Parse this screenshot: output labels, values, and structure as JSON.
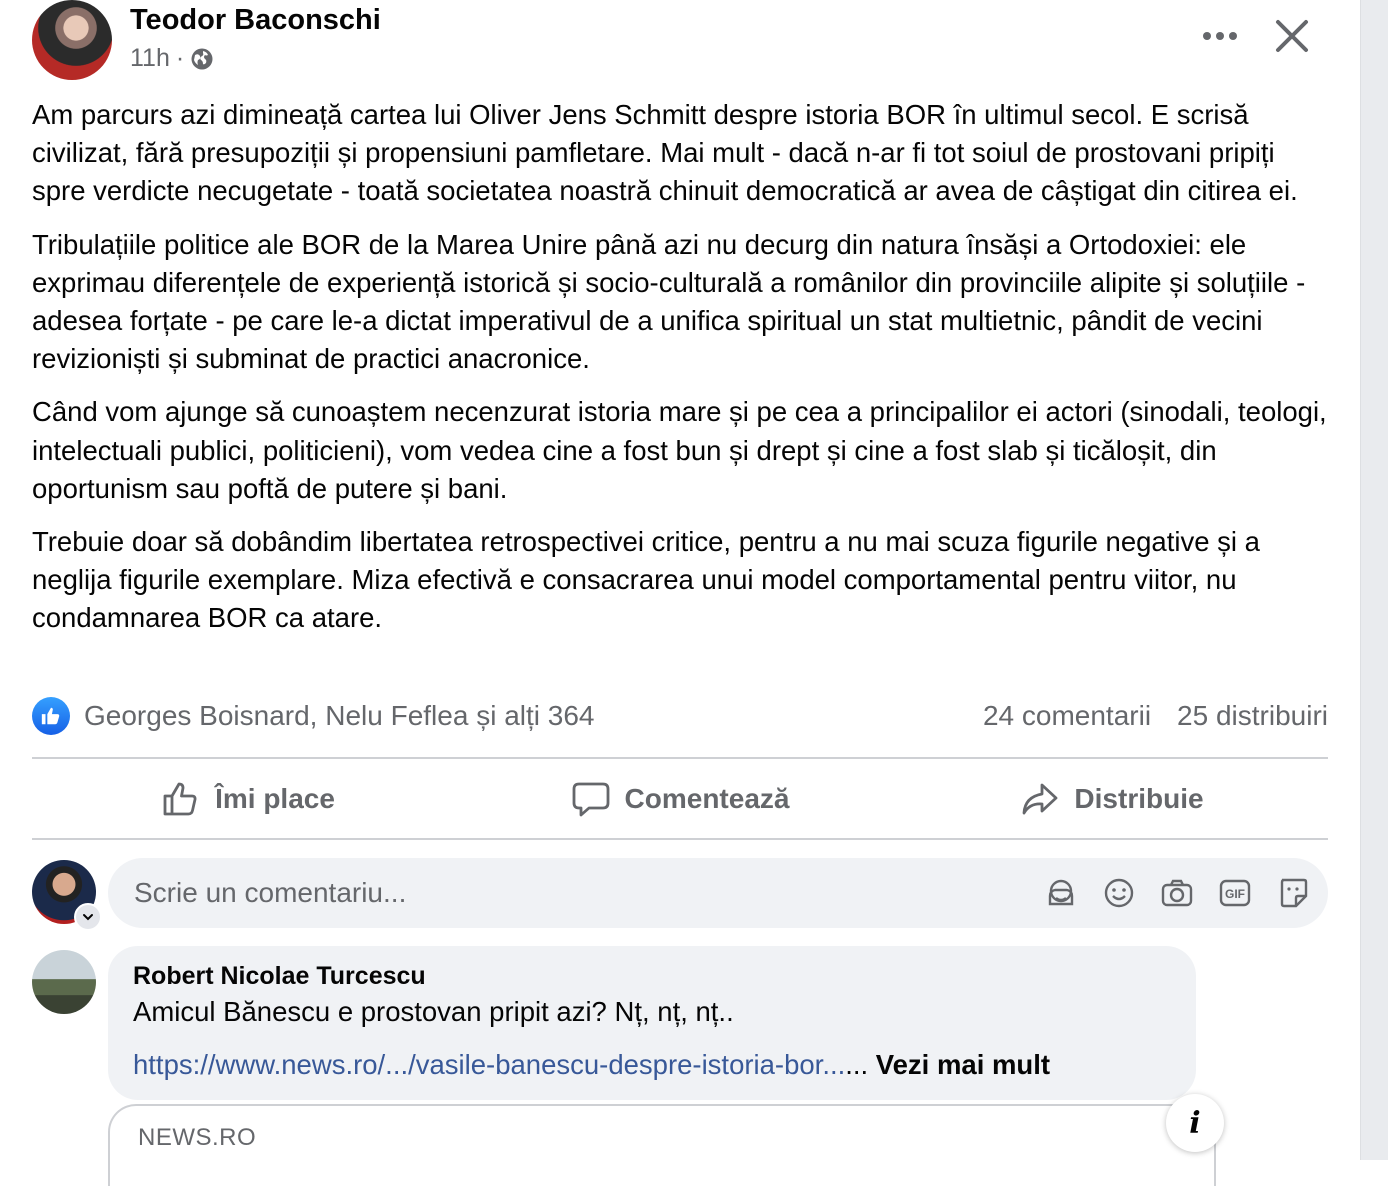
{
  "post": {
    "author": "Teodor Baconschi",
    "time": "11h",
    "time_sep": "·",
    "visibility_icon": "globe-icon",
    "paragraphs": [
      "Am parcurs azi dimineață cartea lui Oliver Jens Schmitt despre istoria BOR în ultimul secol. E scrisă civilizat, fără presupoziții și propensiuni pamfletare. Mai mult - dacă n-ar fi tot soiul de prostovani pripiți spre verdicte necugetate - toată societatea noastră chinuit democratică ar avea de câștigat din citirea ei.",
      "Tribulațiile politice ale BOR de la Marea Unire până azi nu decurg din natura însăși a Ortodoxiei: ele exprimau diferențele de experiență istorică și socio-culturală a românilor din provinciile alipite și soluțiile - adesea forțate - pe care le-a dictat imperativul de a unifica spiritual un stat multietnic, pândit de vecini revizioniști și subminat de practici anacronice.",
      "Când vom ajunge să cunoaștem necenzurat istoria mare și pe cea a principalilor ei actori (sinodali, teologi, intelectuali publici, politicieni), vom vedea cine a fost bun și drept și cine a fost slab și ticăloșit, din oportunism sau poftă de putere și bani.",
      "Trebuie doar să dobândim libertatea retrospectivei critice, pentru a nu mai scuza figurile negative și a neglija figurile exemplare. Miza efectivă e consacrarea unui model comportamental pentru viitor, nu condamnarea BOR ca atare."
    ]
  },
  "reactions": {
    "names": "Georges Boisnard, Nelu Feflea și alți 364",
    "comments": "24 comentarii",
    "shares": "25 distribuiri"
  },
  "actions": {
    "like": "Îmi place",
    "comment": "Comentează",
    "share": "Distribuie"
  },
  "comment_input": {
    "placeholder": "Scrie un comentariu..."
  },
  "comment": {
    "author": "Robert Nicolae Turcescu",
    "text": "Amicul Bănescu e prostovan pripit azi? Nț, nț, nț..",
    "link": "https://www.news.ro/.../vasile-banescu-despre-istoria-bor...",
    "ellipsis": "...",
    "see_more": "Vezi mai mult"
  },
  "link_preview": {
    "domain": "NEWS.RO"
  },
  "colors": {
    "secondary_text": "#65676b",
    "link": "#385898",
    "like_blue": "#1877f2",
    "bubble_bg": "#f0f2f5"
  }
}
